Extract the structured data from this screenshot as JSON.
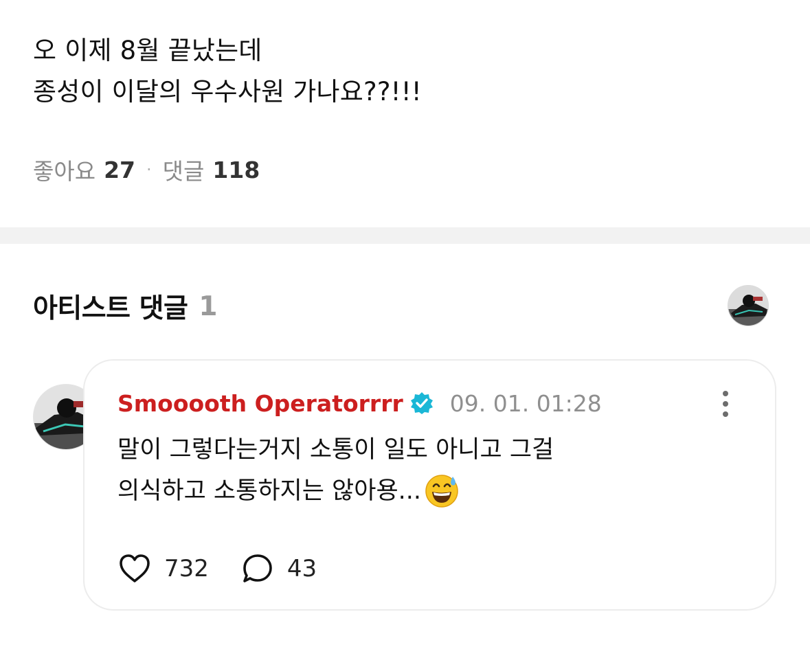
{
  "post": {
    "lines": [
      "오 이제 8월 끝났는데",
      "종성이 이달의 우수사원 가나요??!!!"
    ],
    "likes_label": "좋아요",
    "likes_count": "27",
    "separator": "·",
    "comments_label": "댓글",
    "comments_count": "118"
  },
  "artist_comments": {
    "title": "아티스트 댓글",
    "count": "1"
  },
  "comment": {
    "author": "Smooooth Operatorrrr",
    "timestamp": "09. 01. 01:28",
    "lines": [
      "말이 그렇다는거지 소통이 일도 아니고 그걸",
      "의식하고 소통하지는 않아용..."
    ],
    "emoji": "😅",
    "like_count": "732",
    "reply_count": "43"
  },
  "colors": {
    "author": "#cc1f1f",
    "verified": "#1ab7d6",
    "divider": "#f2f2f2",
    "muted": "#8a8a8a"
  },
  "icons": {
    "verified": "verified-badge-icon",
    "more": "more-vertical-icon",
    "like": "heart-icon",
    "reply": "speech-bubble-icon",
    "emoji": "grinning-sweat-emoji-icon"
  }
}
